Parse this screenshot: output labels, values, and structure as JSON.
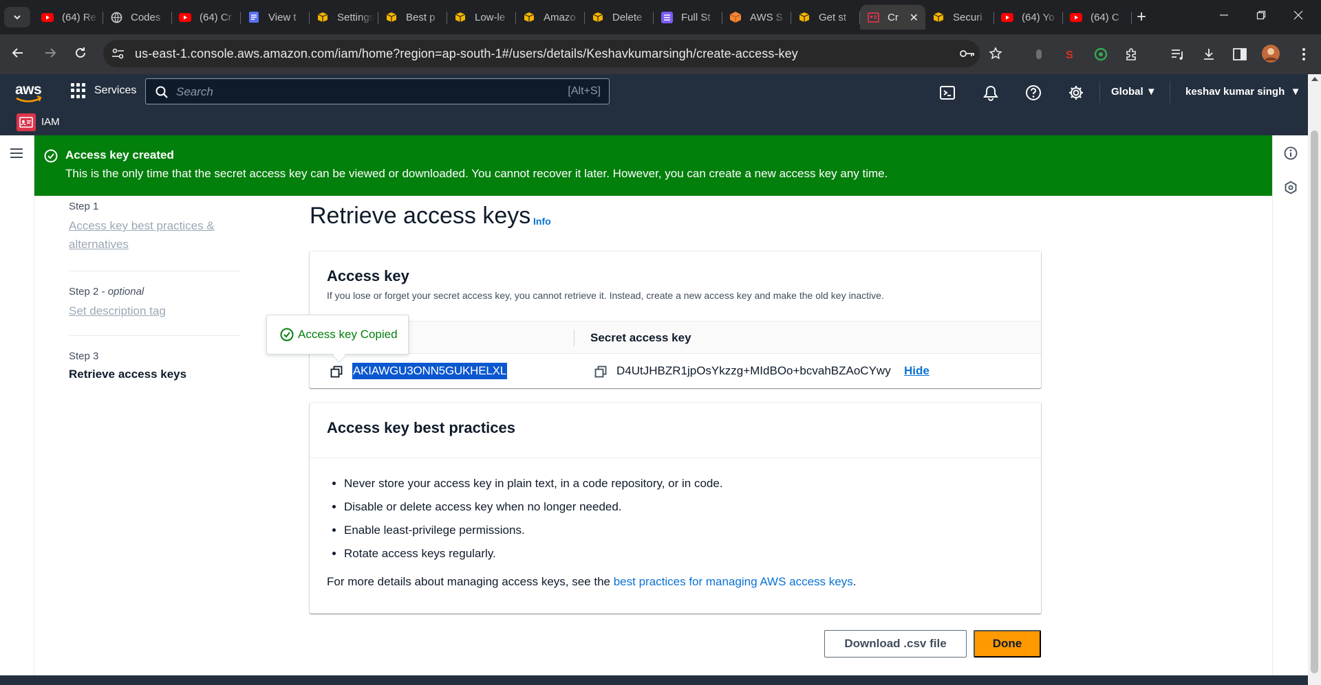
{
  "browser": {
    "tabs": [
      {
        "label": "(64) Re",
        "icon": "youtube-icon",
        "color": "#ff0000"
      },
      {
        "label": "Codes",
        "icon": "globe-icon",
        "color": "#c4c7c5"
      },
      {
        "label": "(64) Cr",
        "icon": "youtube-icon",
        "color": "#ff0000"
      },
      {
        "label": "View t",
        "icon": "doc-icon",
        "color": "#5b6ff5"
      },
      {
        "label": "Settings",
        "icon": "box-icon",
        "color": "#f5b400"
      },
      {
        "label": "Best p",
        "icon": "box-icon",
        "color": "#f5b400"
      },
      {
        "label": "Low-le",
        "icon": "box-icon",
        "color": "#f5b400"
      },
      {
        "label": "Amazo",
        "icon": "box-icon",
        "color": "#f5b400"
      },
      {
        "label": "Delete",
        "icon": "box-icon",
        "color": "#f5b400"
      },
      {
        "label": "Full St",
        "icon": "list-icon",
        "color": "#7b5cf5"
      },
      {
        "label": "AWS S",
        "icon": "cube-icon",
        "color": "#f58534"
      },
      {
        "label": "Get st",
        "icon": "box-icon",
        "color": "#f5b400"
      },
      {
        "label": "Cr",
        "icon": "iam-icon",
        "color": "#dd344c",
        "active": true
      },
      {
        "label": "Securi",
        "icon": "box-icon",
        "color": "#f5b400"
      },
      {
        "label": "(64) Yo",
        "icon": "youtube-icon",
        "color": "#ff0000"
      },
      {
        "label": "(64) C",
        "icon": "youtube-icon",
        "color": "#ff0000"
      }
    ],
    "url": "us-east-1.console.aws.amazon.com/iam/home?region=ap-south-1#/users/details/Keshavkumarsingh/create-access-key"
  },
  "aws_header": {
    "services_label": "Services",
    "search_placeholder": "Search",
    "search_shortcut": "[Alt+S]",
    "region_label": "Global",
    "user_label": "keshav kumar singh",
    "service_name": "IAM"
  },
  "flash": {
    "title": "Access key created",
    "message": "This is the only time that the secret access key can be viewed or downloaded. You cannot recover it later. However, you can create a new access key any time."
  },
  "wizard": {
    "step1_label": "Step 1",
    "step1_title": "Access key best practices & alternatives",
    "step2_label": "Step 2",
    "step2_optional": "optional",
    "step2_title": "Set description tag",
    "step3_label": "Step 3",
    "step3_title": "Retrieve access keys"
  },
  "page": {
    "title": "Retrieve access keys",
    "info_link": "Info"
  },
  "access_key_card": {
    "heading": "Access key",
    "description": "If you lose or forget your secret access key, you cannot retrieve it. Instead, create a new access key and make the old key inactive.",
    "col_secret": "Secret access key",
    "access_key_value": "AKIAWGU3ONN5GUKHELXL",
    "secret_key_value": "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",
    "hide_label": "Hide",
    "tooltip_text": "Access key Copied"
  },
  "best_practices": {
    "heading": "Access key best practices",
    "items": [
      "Never store your access key in plain text, in a code repository, or in code.",
      "Disable or delete access key when no longer needed.",
      "Enable least-privilege permissions.",
      "Rotate access keys regularly."
    ],
    "more_prefix": "For more details about managing access keys, see the ",
    "more_link": "best practices for managing AWS access keys",
    "more_suffix": "."
  },
  "actions": {
    "download_label": "Download .csv file",
    "done_label": "Done"
  },
  "colors": {
    "aws_nav": "#232f3e",
    "success": "#037f0c",
    "primary_button": "#ff9900",
    "link": "#0972d3"
  }
}
